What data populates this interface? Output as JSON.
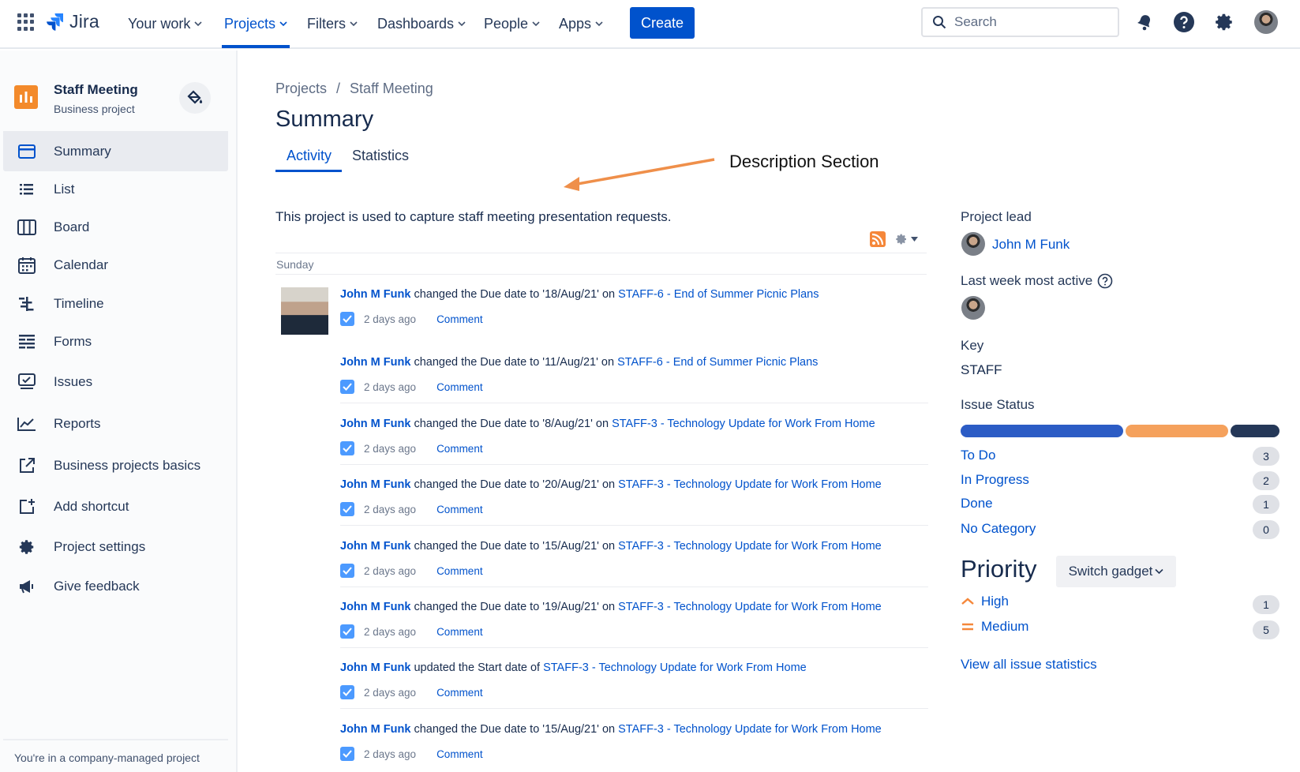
{
  "topnav": {
    "logo_text": "Jira",
    "items": [
      {
        "label": "Your work"
      },
      {
        "label": "Projects"
      },
      {
        "label": "Filters"
      },
      {
        "label": "Dashboards"
      },
      {
        "label": "People"
      },
      {
        "label": "Apps"
      }
    ],
    "create_label": "Create",
    "search_placeholder": "Search",
    "accent": "#0052cc"
  },
  "sidebar": {
    "project_name": "Staff Meeting",
    "project_type": "Business project",
    "items": [
      {
        "label": "Summary",
        "icon": "summary-icon"
      },
      {
        "label": "List",
        "icon": "list-icon"
      },
      {
        "label": "Board",
        "icon": "board-icon"
      },
      {
        "label": "Calendar",
        "icon": "calendar-icon"
      },
      {
        "label": "Timeline",
        "icon": "timeline-icon"
      },
      {
        "label": "Forms",
        "icon": "forms-icon"
      },
      {
        "label": "Issues",
        "icon": "issues-icon"
      },
      {
        "label": "Reports",
        "icon": "reports-icon"
      },
      {
        "label": "Business projects basics",
        "icon": "external-link-icon"
      },
      {
        "label": "Add shortcut",
        "icon": "add-shortcut-icon"
      },
      {
        "label": "Project settings",
        "icon": "gear-icon"
      },
      {
        "label": "Give feedback",
        "icon": "megaphone-icon"
      }
    ],
    "footer": "You're in a company-managed project"
  },
  "main": {
    "breadcrumb": {
      "projects": "Projects",
      "separator": "/",
      "current": "Staff Meeting"
    },
    "title": "Summary",
    "tabs": [
      {
        "label": "Activity"
      },
      {
        "label": "Statistics"
      }
    ],
    "annotation": "Description Section",
    "description": "This project is used to capture staff meeting presentation requests.",
    "day_label": "Sunday",
    "activity": [
      {
        "user": "John M Funk",
        "action": "changed the Due date to '18/Aug/21' on",
        "issue": "STAFF-6 - End of Summer Picnic Plans",
        "time": "2 days ago",
        "comment": "Comment"
      },
      {
        "user": "John M Funk",
        "action": "changed the Due date to '11/Aug/21' on",
        "issue": "STAFF-6 - End of Summer Picnic Plans",
        "time": "2 days ago",
        "comment": "Comment"
      },
      {
        "user": "John M Funk",
        "action": "changed the Due date to '8/Aug/21' on",
        "issue": "STAFF-3 - Technology Update for Work From Home",
        "time": "2 days ago",
        "comment": "Comment"
      },
      {
        "user": "John M Funk",
        "action": "changed the Due date to '20/Aug/21' on",
        "issue": "STAFF-3 - Technology Update for Work From Home",
        "time": "2 days ago",
        "comment": "Comment"
      },
      {
        "user": "John M Funk",
        "action": "changed the Due date to '15/Aug/21' on",
        "issue": "STAFF-3 - Technology Update for Work From Home",
        "time": "2 days ago",
        "comment": "Comment"
      },
      {
        "user": "John M Funk",
        "action": "changed the Due date to '19/Aug/21' on",
        "issue": "STAFF-3 - Technology Update for Work From Home",
        "time": "2 days ago",
        "comment": "Comment"
      },
      {
        "user": "John M Funk",
        "action": "updated the Start date of",
        "issue": "STAFF-3 - Technology Update for Work From Home",
        "time": "2 days ago",
        "comment": "Comment"
      },
      {
        "user": "John M Funk",
        "action": "changed the Due date to '15/Aug/21' on",
        "issue": "STAFF-3 - Technology Update for Work From Home",
        "time": "2 days ago",
        "comment": "Comment"
      }
    ]
  },
  "panel": {
    "lead_label": "Project lead",
    "lead_name": "John M Funk",
    "most_active_label": "Last week most active",
    "key_label": "Key",
    "key_value": "STAFF",
    "issue_status_label": "Issue Status",
    "statuses": [
      {
        "label": "To Do",
        "count": "3",
        "color": "#2c5cc5"
      },
      {
        "label": "In Progress",
        "count": "2",
        "color": "#f5a15c"
      },
      {
        "label": "Done",
        "count": "1",
        "color": "#253858"
      },
      {
        "label": "No Category",
        "count": "0",
        "color": "#dfe1e6"
      }
    ],
    "priority_title": "Priority",
    "switch_gadget": "Switch gadget",
    "priorities": [
      {
        "label": "High",
        "count": "1",
        "icon": "priority-high-icon"
      },
      {
        "label": "Medium",
        "count": "5",
        "icon": "priority-medium-icon"
      }
    ],
    "view_all": "View all issue statistics"
  }
}
